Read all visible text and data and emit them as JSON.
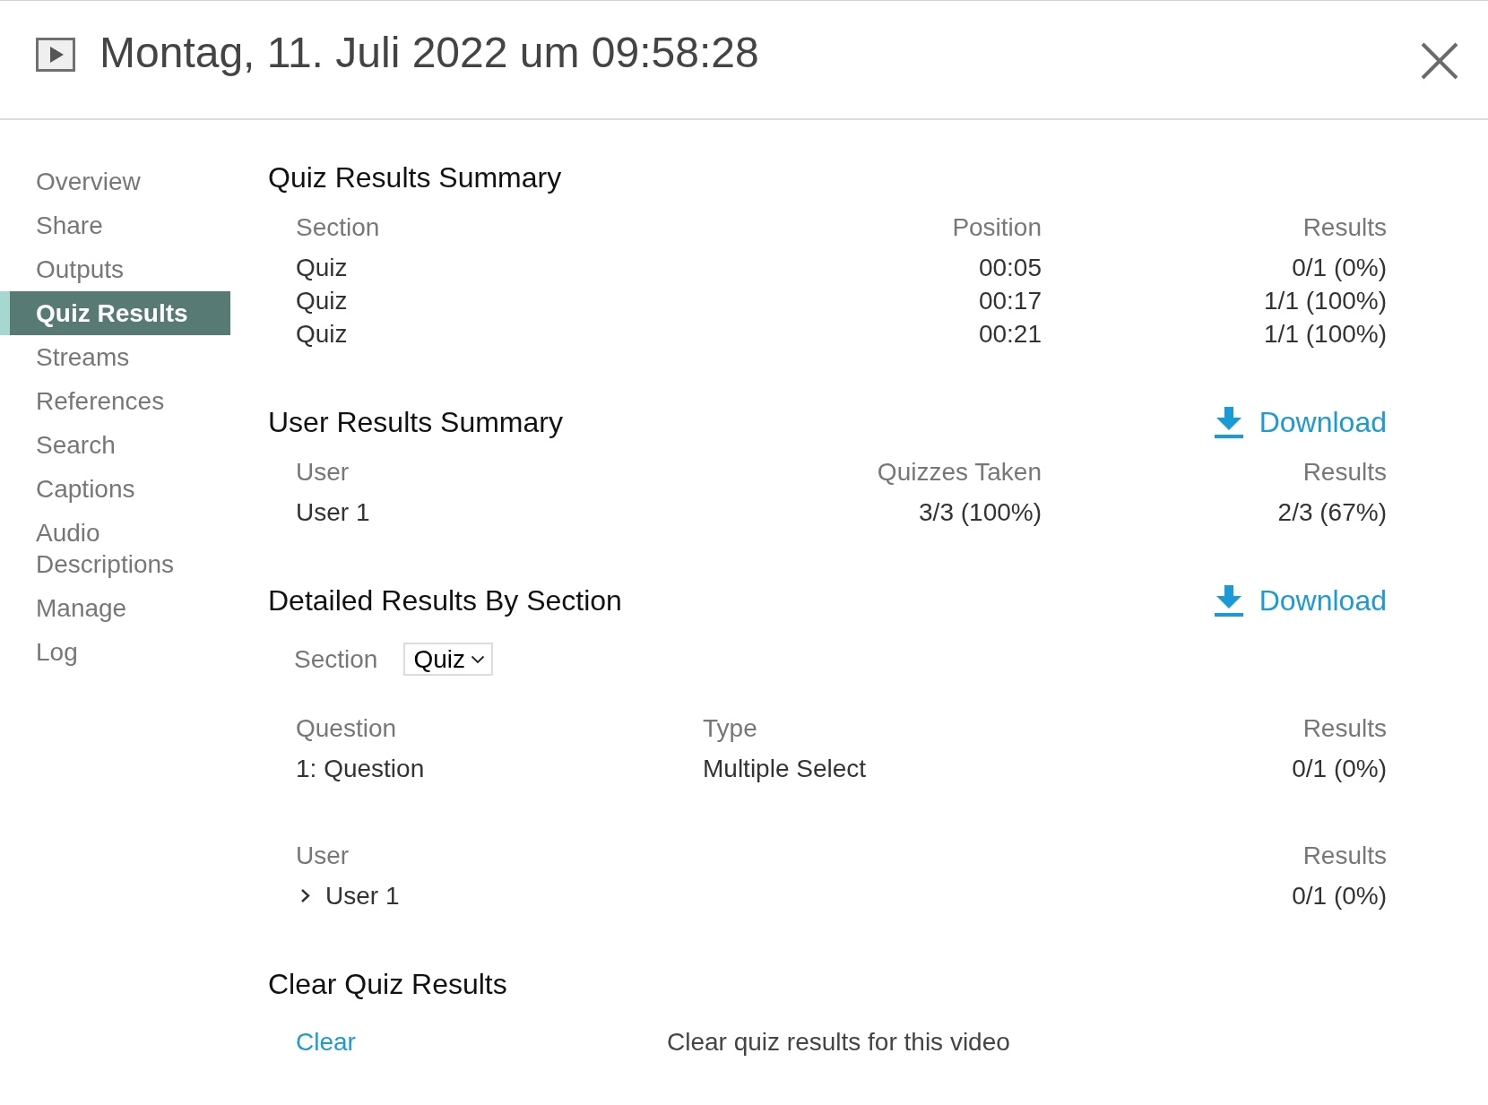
{
  "header": {
    "title": "Montag, 11. Juli 2022 um 09:58:28"
  },
  "sidebar": {
    "items": [
      {
        "label": "Overview",
        "selected": false
      },
      {
        "label": "Share",
        "selected": false
      },
      {
        "label": "Outputs",
        "selected": false
      },
      {
        "label": "Quiz Results",
        "selected": true
      },
      {
        "label": "Streams",
        "selected": false
      },
      {
        "label": "References",
        "selected": false
      },
      {
        "label": "Search",
        "selected": false
      },
      {
        "label": "Captions",
        "selected": false
      },
      {
        "label": "Audio Descriptions",
        "selected": false
      },
      {
        "label": "Manage",
        "selected": false
      },
      {
        "label": "Log",
        "selected": false
      }
    ]
  },
  "quiz_results_summary": {
    "title": "Quiz Results Summary",
    "table": {
      "columns": [
        "Section",
        "Position",
        "Results"
      ],
      "rows": [
        [
          "Quiz",
          "00:05",
          "0/1 (0%)"
        ],
        [
          "Quiz",
          "00:17",
          "1/1 (100%)"
        ],
        [
          "Quiz",
          "00:21",
          "1/1 (100%)"
        ]
      ]
    }
  },
  "user_results_summary": {
    "title": "User Results Summary",
    "download": "Download",
    "table": {
      "columns": [
        "User",
        "Quizzes Taken",
        "Results"
      ],
      "rows": [
        [
          "User 1",
          "3/3 (100%)",
          "2/3 (67%)"
        ]
      ]
    }
  },
  "detailed_results_by_section": {
    "title": "Detailed Results By Section",
    "download": "Download",
    "section_filter": {
      "label": "Section",
      "value": "Quiz"
    },
    "questions": {
      "columns": [
        "Question",
        "Type",
        "Results"
      ],
      "rows": [
        [
          "1: Question",
          "Multiple Select",
          "0/1 (0%)"
        ]
      ]
    },
    "users": {
      "columns": [
        "User",
        "Results"
      ],
      "rows": [
        {
          "cells": [
            "User 1",
            "0/1 (0%)"
          ],
          "expanded": false
        }
      ]
    }
  },
  "clear_quiz_results": {
    "title": "Clear Quiz Results",
    "link": "Clear",
    "description": "Clear quiz results for this video"
  }
}
